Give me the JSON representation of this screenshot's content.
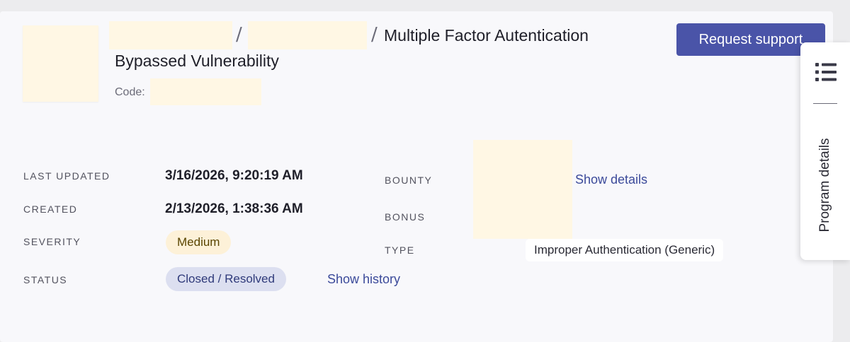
{
  "header": {
    "breadcrumb_separator": "/",
    "title_line1": "Multiple Factor Autentication",
    "title_line2": "Bypassed Vulnerability",
    "code_label": "Code:",
    "request_support_label": "Request support"
  },
  "details": {
    "last_updated": {
      "label": "LAST UPDATED",
      "value": "3/16/2026, 9:20:19 AM"
    },
    "created": {
      "label": "CREATED",
      "value": "2/13/2026, 1:38:36 AM"
    },
    "severity": {
      "label": "SEVERITY",
      "value": "Medium"
    },
    "status": {
      "label": "STATUS",
      "value": "Closed / Resolved",
      "history_link": "Show history"
    },
    "bounty": {
      "label": "BOUNTY",
      "details_link": "Show details"
    },
    "bonus": {
      "label": "BONUS"
    },
    "type": {
      "label": "TYPE",
      "value": "Improper Authentication (Generic)"
    }
  },
  "side_panel": {
    "label": "Program details",
    "icon": "list-icon"
  },
  "colors": {
    "accent": "#4a54a8",
    "link": "#3b4a9a",
    "severity_medium_bg": "#fdf1d8",
    "status_closed_bg": "#dcdff0",
    "redaction": "#fff7e4"
  }
}
